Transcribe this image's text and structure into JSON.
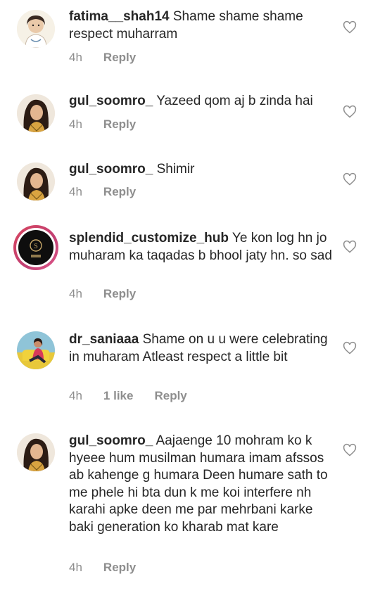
{
  "comments": [
    {
      "username": "fatima__shah14",
      "text": "Shame shame shame respect muharram",
      "time": "4h",
      "likes": "",
      "reply": "Reply",
      "avatar": "cartoon-girl"
    },
    {
      "username": "gul_soomro_",
      "text": "Yazeed qom aj b zinda hai",
      "time": "4h",
      "likes": "",
      "reply": "Reply",
      "avatar": "woman-portrait"
    },
    {
      "username": "gul_soomro_",
      "text": "Shimir",
      "time": "4h",
      "likes": "",
      "reply": "Reply",
      "avatar": "woman-portrait"
    },
    {
      "username": "splendid_customize_hub",
      "text": "Ye kon log hn jo muharam ka taqadas b bhool jaty hn. so sad",
      "time": "4h",
      "likes": "",
      "reply": "Reply",
      "avatar": "brand-logo"
    },
    {
      "username": "dr_saniaaa",
      "text": "Shame on u u were celebrating in muharam Atleast respect a little bit",
      "time": "4h",
      "likes": "1 like",
      "reply": "Reply",
      "avatar": "woman-yellow-sofa"
    },
    {
      "username": "gul_soomro_",
      "text": "Aajaenge 10 mohram ko k hyeee hum musilman humara imam afssos ab kahenge g humara Deen humare sath to me phele hi bta dun k me koi interfere nh karahi apke deen me par mehrbani karke baki generation ko kharab mat kare",
      "time": "4h",
      "likes": "",
      "reply": "Reply",
      "avatar": "woman-portrait"
    }
  ]
}
